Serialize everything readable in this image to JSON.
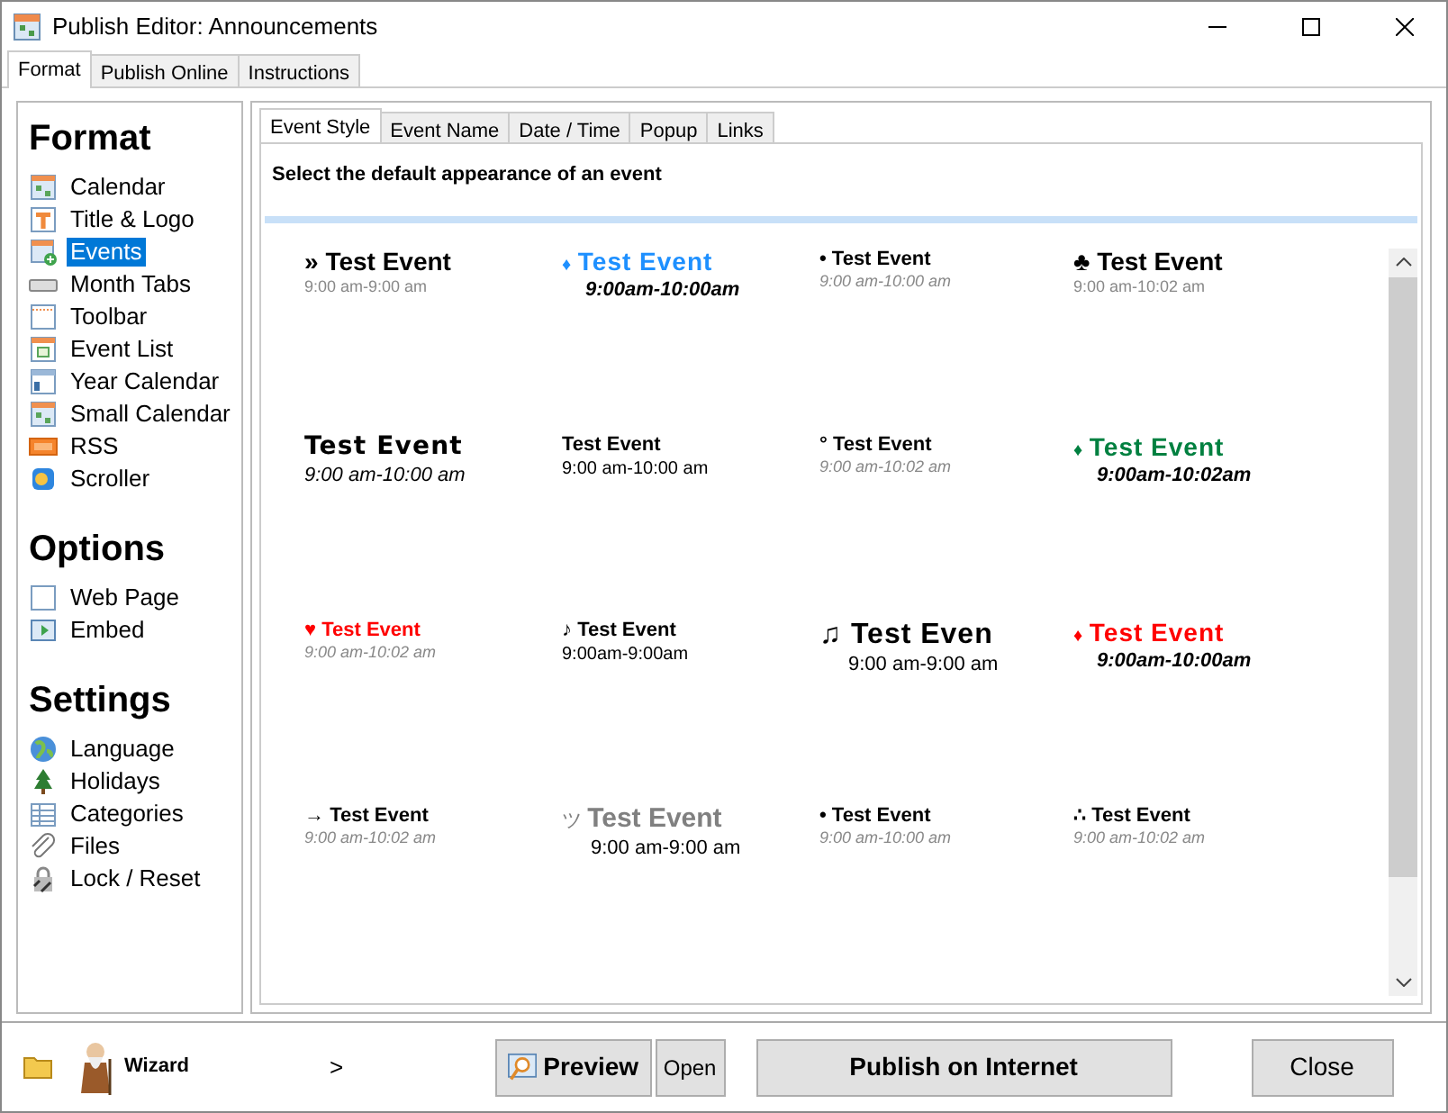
{
  "window": {
    "title": "Publish Editor: Announcements"
  },
  "tabs": [
    {
      "label": "Format",
      "selected": true
    },
    {
      "label": "Publish Online",
      "selected": false
    },
    {
      "label": "Instructions",
      "selected": false
    }
  ],
  "sidebar": {
    "sections": [
      {
        "heading": "Format",
        "items": [
          {
            "label": "Calendar",
            "kind": "calendar",
            "selected": false
          },
          {
            "label": "Title & Logo",
            "kind": "title",
            "selected": false
          },
          {
            "label": "Events",
            "kind": "events",
            "selected": true
          },
          {
            "label": "Month Tabs",
            "kind": "tabs",
            "selected": false
          },
          {
            "label": "Toolbar",
            "kind": "toolbar",
            "selected": false
          },
          {
            "label": "Event List",
            "kind": "list",
            "selected": false
          },
          {
            "label": "Year Calendar",
            "kind": "year",
            "selected": false
          },
          {
            "label": "Small Calendar",
            "kind": "calendar",
            "selected": false
          },
          {
            "label": "RSS",
            "kind": "rss",
            "selected": false
          },
          {
            "label": "Scroller",
            "kind": "scroller",
            "selected": false
          }
        ]
      },
      {
        "heading": "Options",
        "items": [
          {
            "label": "Web Page",
            "kind": "page",
            "selected": false
          },
          {
            "label": "Embed",
            "kind": "embed",
            "selected": false
          }
        ]
      },
      {
        "heading": "Settings",
        "items": [
          {
            "label": "Language",
            "kind": "globe",
            "selected": false
          },
          {
            "label": "Holidays",
            "kind": "tree",
            "selected": false
          },
          {
            "label": "Categories",
            "kind": "table",
            "selected": false
          },
          {
            "label": "Files",
            "kind": "clip",
            "selected": false
          },
          {
            "label": "Lock / Reset",
            "kind": "lock",
            "selected": false
          }
        ]
      }
    ]
  },
  "subtabs": [
    {
      "label": "Event Style",
      "selected": true
    },
    {
      "label": "Event Name",
      "selected": false
    },
    {
      "label": "Date / Time",
      "selected": false
    },
    {
      "label": "Popup",
      "selected": false
    },
    {
      "label": "Links",
      "selected": false
    }
  ],
  "instruction": "Select the default appearance of an event",
  "events": [
    {
      "marker": "»",
      "title": "Test Event",
      "time": "9:00 am-9:00 am",
      "kind": "plain",
      "color": "#000000"
    },
    {
      "marker": "♦",
      "title": "Test Event",
      "time": "9:00am-10:00am",
      "kind": "wide",
      "color": "#1e90ff"
    },
    {
      "marker": "•",
      "title": "Test Event",
      "time": "9:00 am-10:00 am",
      "kind": "small",
      "color": "#000000"
    },
    {
      "marker": "♣",
      "title": "Test Event",
      "time": "9:00 am-10:02 am",
      "kind": "plain",
      "color": "#000000"
    },
    {
      "title": "Test Event",
      "time": "9:00 am-10:00 am",
      "kind": "comic",
      "color": "#000000"
    },
    {
      "title": "Test Event",
      "time": "9:00 am-10:00 am",
      "kind": "compact",
      "color": "#000000"
    },
    {
      "marker": "°",
      "title": "Test Event",
      "time": "9:00 am-10:02 am",
      "kind": "small",
      "color": "#000000"
    },
    {
      "marker": "♦",
      "title": "Test Event",
      "time": "9:00am-10:02am",
      "kind": "wide",
      "color": "#008040"
    },
    {
      "marker": "♥",
      "title": "Test Event",
      "time": "9:00 am-10:02 am",
      "kind": "small",
      "color": "#ff0000"
    },
    {
      "marker": "♪",
      "title": "Test Event",
      "time": "9:00am-9:00am",
      "kind": "compact",
      "color": "#000000"
    },
    {
      "marker": "♫",
      "title": "Test Even",
      "time": "9:00 am-9:00 am",
      "kind": "large",
      "color": "#000000"
    },
    {
      "marker": "♦",
      "title": "Test Event",
      "time": "9:00am-10:00am",
      "kind": "wide",
      "color": "#ff0000"
    },
    {
      "marker": "→",
      "title": "Test Event",
      "time": "9:00 am-10:02 am",
      "kind": "small",
      "color": "#000000"
    },
    {
      "marker": "ツ",
      "title": "Test Event",
      "time": "9:00 am-9:00 am",
      "kind": "faded",
      "color": "#808080"
    },
    {
      "marker": "•",
      "title": "Test Event",
      "time": "9:00 am-10:00 am",
      "kind": "small",
      "color": "#000000"
    },
    {
      "marker": "∴",
      "title": "Test Event",
      "time": "9:00 am-10:02 am",
      "kind": "small",
      "color": "#000000"
    }
  ],
  "footer": {
    "wizard": "Wizard",
    "next": ">",
    "buttons": [
      {
        "label": "Preview",
        "kind": "preview"
      },
      {
        "label": "Open",
        "kind": "small"
      },
      {
        "label": "Publish on Internet",
        "kind": "wide"
      },
      {
        "label": "Close",
        "kind": "close"
      }
    ]
  }
}
